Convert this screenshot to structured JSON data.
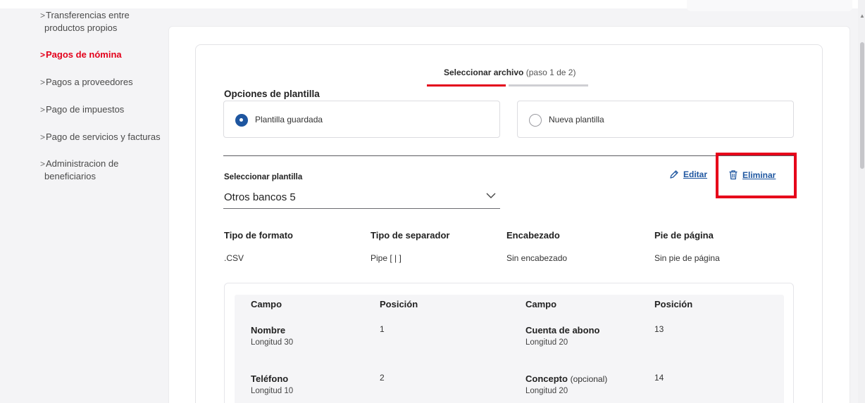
{
  "sidebar": {
    "items": [
      {
        "label_l1": "Transferencias entre",
        "label_l2": "productos propios"
      },
      {
        "label": "Pagos de nómina"
      },
      {
        "label": "Pagos a proveedores"
      },
      {
        "label": "Pago de impuestos"
      },
      {
        "label": "Pago de servicios y facturas"
      },
      {
        "label_l1": "Administracion de",
        "label_l2": "beneficiarios"
      }
    ],
    "chevron": ">"
  },
  "stepper": {
    "title": "Seleccionar archivo",
    "step": "(paso 1 de 2)"
  },
  "template_options": {
    "heading": "Opciones de plantilla",
    "saved_label": "Plantilla guardada",
    "new_label": "Nueva plantilla",
    "selected": "Plantilla guardada"
  },
  "select_template": {
    "label": "Seleccionar plantilla",
    "value": "Otros bancos 5"
  },
  "actions": {
    "edit_label": "Editar",
    "delete_label": "Eliminar"
  },
  "info": {
    "format_head": "Tipo de formato",
    "format_val": ".CSV",
    "separator_head": "Tipo de separador",
    "separator_val": "Pipe [ | ]",
    "header_head": "Encabezado",
    "header_val": "Sin encabezado",
    "footer_head": "Pie de página",
    "footer_val": "Sin pie de página"
  },
  "fields_table": {
    "col_campo": "Campo",
    "col_posicion": "Posición",
    "rows": [
      {
        "name": "Nombre",
        "opt": "",
        "length": "Longitud 30",
        "pos": "1"
      },
      {
        "name": "Teléfono",
        "opt": "",
        "length": "Longitud 10",
        "pos": "2"
      },
      {
        "name": "Cuenta de abono",
        "opt": "",
        "length": "Longitud 20",
        "pos": "13"
      },
      {
        "name": "Concepto",
        "opt": "(opcional)",
        "length": "Longitud 20",
        "pos": "14"
      }
    ]
  },
  "colors": {
    "accent_red": "#e3001b",
    "link_blue": "#1e56a0"
  }
}
